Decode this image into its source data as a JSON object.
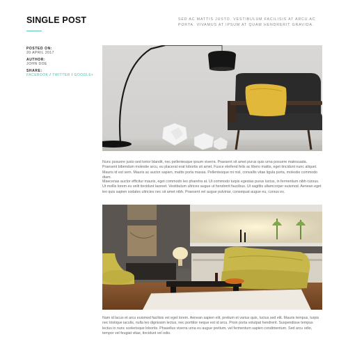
{
  "page": {
    "title": "SINGLE POST",
    "tagline": "SED AC MATTIS JUSTO. VESTIBULUM FACILISIS AT ARCU AC PORTA. VIVAMUS AT IPSUM AT QUAM HENDRERIT GRAVIDA."
  },
  "meta": {
    "posted_label": "POSTED ON:",
    "posted_value": "20 APRIL 2017",
    "author_label": "AUTHOR:",
    "author_value": "JOHN DOE",
    "share_label": "SHARE:",
    "share_links": [
      "FACEBOOK",
      "TWITTER",
      "GOOGLE+"
    ],
    "share_separator": "/"
  },
  "colors": {
    "accent": "#46c0ad",
    "title_rule": "#5cc8b8"
  },
  "content": {
    "paragraphs": [
      "Nunc posuere justo sed tortor blandit, nec pellentesque ipsum viverra. Praesent sit amet purus quis urna posuere malesuada. Praesent bibendum molestie arcu, eu placerat erat lobortis sit amet. Fusce eleifend felis ac libero mattis, eget tincidunt nunc aliquet. Mauris id est sem. Mauris ac auctor sapien, mattis porta massa. Pellentesque mi nisl, convallis vitae ligula porta, molestie commodo diam.",
      "Maecenas auctor efficitur mauris, eget commodo leo pharetra at. Ut commodo turpis egestas purus luctus, in fermentum nibh cursus. Ut mollis lorem eu velit tincidunt laoreet. Vestibulum ultrices augue ut hendrerit faucibus. Ut sagittis ullamcorper euismod. Aenean eget leo quis sapien sodales ultricies nec sit amet nibh. Praesent vel augue pulvinar, consequat augue eu, cursus ex.",
      "Nam id lacus et arcu euismod facilisis vel eget lorem. Aenean sapien elit, pretium et varius quis, luctus sed elit. Mauris tempus, turpis nec tristique iaculis, nulla leo dignissim lectus, nec porttitor neque est id arcu. Proin porta volutpat hendrerit. Suspendisse tempus lectus in nunc scelerisque lobortis. Phasellus viverra urna eu augue pretium, vel fermentum sapien condimentum. Sed arcu odio, tempor vel feugiat vitae, tincidunt vel odio."
    ],
    "images": [
      {
        "alt": "arc-floor-lamp-and-armchair"
      },
      {
        "alt": "living-room-with-yellow-sofa"
      }
    ]
  }
}
